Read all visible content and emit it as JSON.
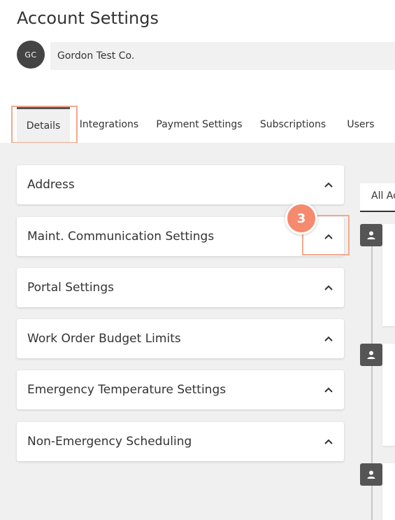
{
  "header": {
    "title": "Account Settings",
    "avatar_initials": "GC",
    "company_name": "Gordon Test Co."
  },
  "tabs": [
    {
      "label": "Details",
      "active": true
    },
    {
      "label": "Integrations",
      "active": false
    },
    {
      "label": "Payment Settings",
      "active": false
    },
    {
      "label": "Subscriptions",
      "active": false
    },
    {
      "label": "Users",
      "active": false
    }
  ],
  "panels": [
    {
      "label": "Address",
      "icon": "chevron-up-icon"
    },
    {
      "label": "Maint. Communication Settings",
      "icon": "chevron-up-icon"
    },
    {
      "label": "Portal Settings",
      "icon": "chevron-up-icon"
    },
    {
      "label": "Work Order Budget Limits",
      "icon": "chevron-up-icon"
    },
    {
      "label": "Emergency Temperature Settings",
      "icon": "chevron-up-icon"
    },
    {
      "label": "Non-Emergency Scheduling",
      "icon": "chevron-up-icon"
    }
  ],
  "callout": {
    "step": "3"
  },
  "activity": {
    "tab_label": "All Ac"
  },
  "colors": {
    "highlight": "#f2a98e",
    "step_badge": "#f58a6e",
    "avatar_bg": "#444444",
    "content_bg": "#f0f0f0"
  }
}
